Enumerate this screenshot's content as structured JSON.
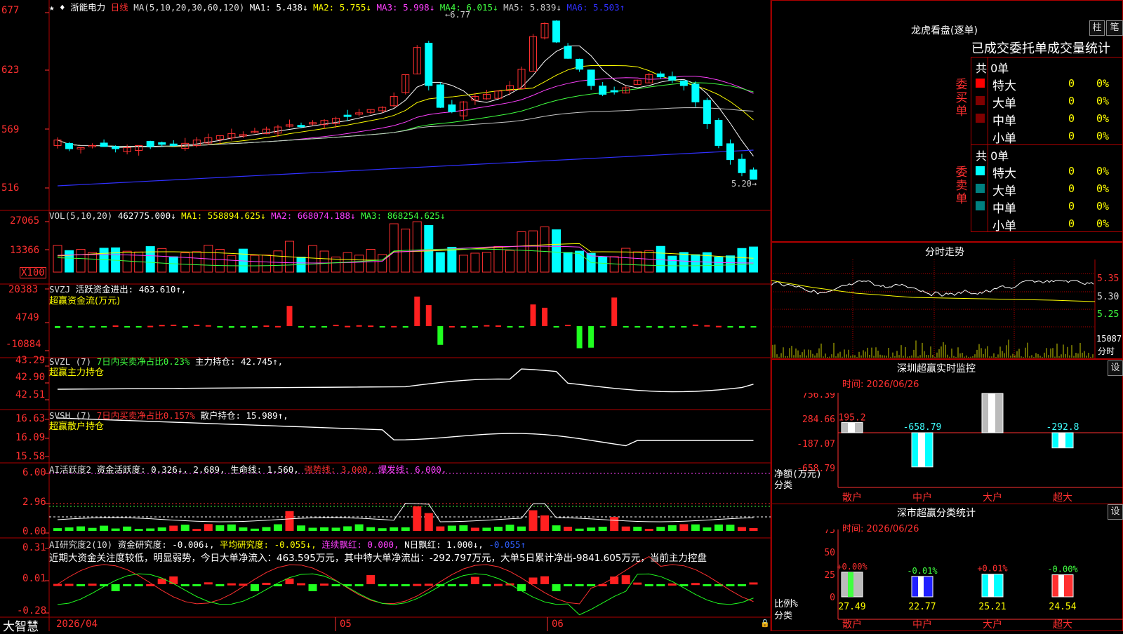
{
  "stock": {
    "name": "浙能电力",
    "period": "日线",
    "ma_label": "MA(5,10,20,30,60,120)",
    "ma": [
      {
        "label": "MA1: 5.438↓",
        "color": "#ffffff"
      },
      {
        "label": "MA2: 5.755↓",
        "color": "#ffff00"
      },
      {
        "label": "MA3: 5.998↓",
        "color": "#ff40ff"
      },
      {
        "label": "MA4: 6.015↓",
        "color": "#40ff40"
      },
      {
        "label": "MA5: 5.839↓",
        "color": "#c8c8c8"
      },
      {
        "label": "MA6: 5.503↑",
        "color": "#3030ff"
      }
    ],
    "price_axis": [
      "677",
      "623",
      "569",
      "516"
    ],
    "high_label": "6.77",
    "low_label": "5.20"
  },
  "vol": {
    "title": "VOL(5,10,20)",
    "val": "462775.000↓",
    "ma": [
      {
        "label": "MA1: 558894.625↓",
        "color": "#ffff00"
      },
      {
        "label": "MA2: 668074.188↓",
        "color": "#ff40ff"
      },
      {
        "label": "MA3: 868254.625↓",
        "color": "#40ff40"
      }
    ],
    "axis": [
      "27065",
      "13366"
    ],
    "unit": "X100"
  },
  "svzj": {
    "title": "SVZJ",
    "desc": "活跃资金进出: 463.610↑,",
    "sub": "超赢资金流(万元)",
    "axis": [
      "20383",
      "4749",
      "-10884"
    ]
  },
  "svzl": {
    "title": "SVZL (7)",
    "desc1": "7日内买卖净占比0.23%",
    "desc2": "主力持仓: 42.745↑,",
    "sub": "超赢主力持仓",
    "axis": [
      "43.29",
      "42.90",
      "42.51"
    ]
  },
  "svsh": {
    "title": "SVSH (7)",
    "desc1": "7日内买卖净占比0.157%",
    "desc2": "散户持仓: 15.989↑,",
    "sub": "超赢散户持仓",
    "axis": [
      "16.63",
      "16.09",
      "15.58"
    ]
  },
  "ai1": {
    "title": "AI活跃度2",
    "t1": "资金活跃度: 0.326↓,",
    "t2": "2.689,",
    "t3": "生命线: 1.560,",
    "t4": "强势线: 3.000,",
    "t5": "爆发线: 6.000,",
    "axis": [
      "6.00",
      "2.96",
      "0.00"
    ]
  },
  "ai2": {
    "title": "AI研究度2(10)",
    "t1": "资金研究度: -0.006↓,",
    "t2": "平均研究度: -0.055↓,",
    "t3": "连续飘红: 0.000,",
    "t4": "N日飘红: 1.000↓,",
    "t5": "-0.055↑",
    "note": "近期大资金关注度较低，明显弱势，今日大单净流入：463.595万元，其中特大单净流出：-292.797万元，大单5日累计净出-9841.605万元，当前主力控盘",
    "axis": [
      "0.31",
      "0.01",
      "-0.28"
    ]
  },
  "bottom": {
    "logo": "大智慧",
    "dates": [
      "2026/04",
      "05",
      "06"
    ]
  },
  "right": {
    "dragon": {
      "title": "龙虎看盘(逐单)",
      "btn1": "柱",
      "btn2": "笔",
      "subtitle": "已成交委托单成交量统计",
      "buy": {
        "label": "委买单",
        "total": "共 0单",
        "rows": [
          {
            "name": "特大",
            "n": "0",
            "p": "0%",
            "color": "#ff0000"
          },
          {
            "name": "大单",
            "n": "0",
            "p": "0%",
            "color": "#800000"
          },
          {
            "name": "中单",
            "n": "0",
            "p": "0%",
            "color": "#800000"
          },
          {
            "name": "小单",
            "n": "0",
            "p": "0%",
            "color": ""
          }
        ]
      },
      "sell": {
        "label": "委卖单",
        "total": "共 0单",
        "rows": [
          {
            "name": "特大",
            "n": "0",
            "p": "0%",
            "color": "#00ffff"
          },
          {
            "name": "大单",
            "n": "0",
            "p": "0%",
            "color": "#008080"
          },
          {
            "name": "中单",
            "n": "0",
            "p": "0%",
            "color": "#008080"
          },
          {
            "name": "小单",
            "n": "0",
            "p": "0%",
            "color": ""
          }
        ]
      }
    },
    "intraday": {
      "title": "分时走势",
      "axis": [
        "5.35",
        "5.30",
        "5.25"
      ],
      "vol": "15087",
      "vol_unit": "分时"
    },
    "monitor": {
      "title": "深圳超赢实时监控",
      "btn": "设",
      "time": "时间: 2026/06/26",
      "axis": [
        "756.39",
        "284.66",
        "-187.07",
        "-658.79"
      ],
      "ylabel": "净额(万元)",
      "xlabel": "分类",
      "cats": [
        "散户",
        "中户",
        "大户",
        "超大"
      ],
      "vals": [
        "195.2",
        "-658.79",
        "756.39",
        "-292.8"
      ]
    },
    "classify": {
      "title": "深市超赢分类统计",
      "btn": "设",
      "time": "时间: 2026/06/26",
      "axis": [
        "75",
        "50",
        "25",
        "0"
      ],
      "ylabel": "比例%",
      "xlabel": "分类",
      "cats": [
        "散户",
        "中户",
        "大户",
        "超大"
      ],
      "pct": [
        "+0.00%",
        "-0.01%",
        "+0.01%",
        "-0.00%"
      ],
      "vals": [
        "27.49",
        "22.77",
        "25.21",
        "24.54"
      ]
    }
  }
}
